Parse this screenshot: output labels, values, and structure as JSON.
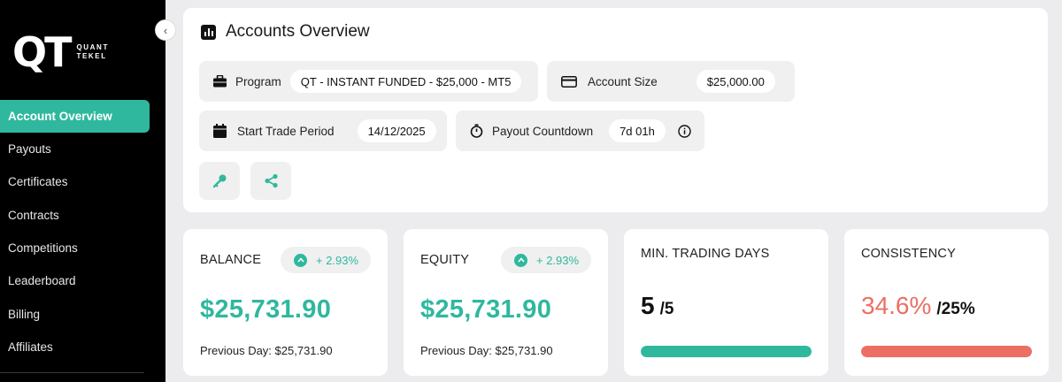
{
  "brand": {
    "mark": "QT",
    "line1": "QUANT",
    "line2": "TEKEL"
  },
  "sidebar": {
    "items": [
      {
        "label": "Account Overview",
        "active": true
      },
      {
        "label": "Payouts"
      },
      {
        "label": "Certificates"
      },
      {
        "label": "Contracts"
      },
      {
        "label": "Competitions"
      },
      {
        "label": "Leaderboard"
      },
      {
        "label": "Billing"
      },
      {
        "label": "Affiliates"
      }
    ],
    "collapse_icon": "chevron-left-icon"
  },
  "overview": {
    "title": "Accounts Overview",
    "program": {
      "label": "Program",
      "value": "QT - INSTANT FUNDED - $25,000 - MT5"
    },
    "account_size": {
      "label": "Account Size",
      "value": "$25,000.00"
    },
    "start_trade": {
      "label": "Start Trade Period",
      "value": "14/12/2025"
    },
    "payout": {
      "label": "Payout Countdown",
      "value": "7d 01h"
    },
    "actions": [
      "key-icon",
      "share-icon"
    ]
  },
  "stats": {
    "balance": {
      "title": "BALANCE",
      "change": "+ 2.93%",
      "value": "$25,731.90",
      "previous": "Previous Day: $25,731.90"
    },
    "equity": {
      "title": "EQUITY",
      "change": "+ 2.93%",
      "value": "$25,731.90",
      "previous": "Previous Day: $25,731.90"
    },
    "min_days": {
      "title": "MIN. TRADING DAYS",
      "value": "5",
      "target": "/5",
      "progress": 1.0
    },
    "consistency": {
      "title": "CONSISTENCY",
      "value": "34.6%",
      "target": "/25%",
      "progress": 1.0
    }
  },
  "colors": {
    "accent": "#2fb89e",
    "danger": "#ec6f63",
    "sidebar": "#000000"
  }
}
